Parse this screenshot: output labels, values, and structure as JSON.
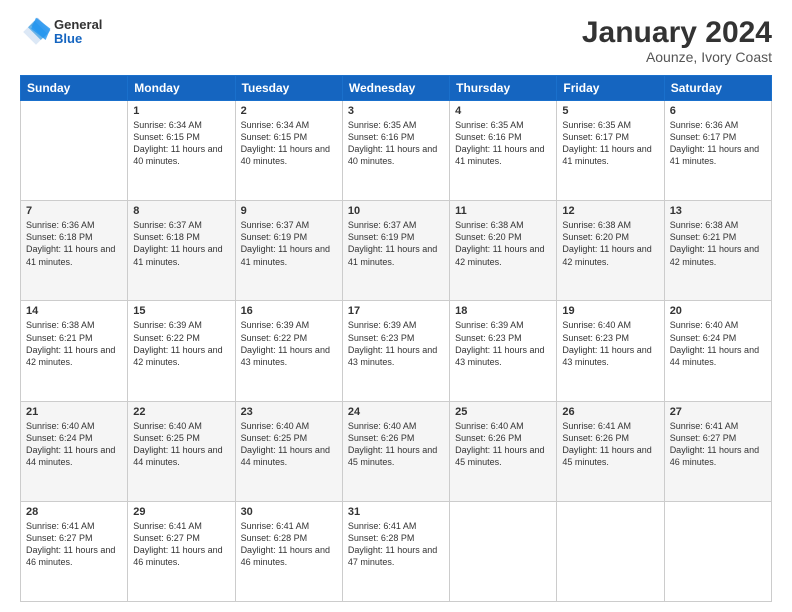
{
  "header": {
    "logo": {
      "general": "General",
      "blue": "Blue"
    },
    "title": "January 2024",
    "subtitle": "Aounze, Ivory Coast"
  },
  "days_of_week": [
    "Sunday",
    "Monday",
    "Tuesday",
    "Wednesday",
    "Thursday",
    "Friday",
    "Saturday"
  ],
  "weeks": [
    [
      {
        "num": "",
        "sunrise": "",
        "sunset": "",
        "daylight": ""
      },
      {
        "num": "1",
        "sunrise": "Sunrise: 6:34 AM",
        "sunset": "Sunset: 6:15 PM",
        "daylight": "Daylight: 11 hours and 40 minutes."
      },
      {
        "num": "2",
        "sunrise": "Sunrise: 6:34 AM",
        "sunset": "Sunset: 6:15 PM",
        "daylight": "Daylight: 11 hours and 40 minutes."
      },
      {
        "num": "3",
        "sunrise": "Sunrise: 6:35 AM",
        "sunset": "Sunset: 6:16 PM",
        "daylight": "Daylight: 11 hours and 40 minutes."
      },
      {
        "num": "4",
        "sunrise": "Sunrise: 6:35 AM",
        "sunset": "Sunset: 6:16 PM",
        "daylight": "Daylight: 11 hours and 41 minutes."
      },
      {
        "num": "5",
        "sunrise": "Sunrise: 6:35 AM",
        "sunset": "Sunset: 6:17 PM",
        "daylight": "Daylight: 11 hours and 41 minutes."
      },
      {
        "num": "6",
        "sunrise": "Sunrise: 6:36 AM",
        "sunset": "Sunset: 6:17 PM",
        "daylight": "Daylight: 11 hours and 41 minutes."
      }
    ],
    [
      {
        "num": "7",
        "sunrise": "Sunrise: 6:36 AM",
        "sunset": "Sunset: 6:18 PM",
        "daylight": "Daylight: 11 hours and 41 minutes."
      },
      {
        "num": "8",
        "sunrise": "Sunrise: 6:37 AM",
        "sunset": "Sunset: 6:18 PM",
        "daylight": "Daylight: 11 hours and 41 minutes."
      },
      {
        "num": "9",
        "sunrise": "Sunrise: 6:37 AM",
        "sunset": "Sunset: 6:19 PM",
        "daylight": "Daylight: 11 hours and 41 minutes."
      },
      {
        "num": "10",
        "sunrise": "Sunrise: 6:37 AM",
        "sunset": "Sunset: 6:19 PM",
        "daylight": "Daylight: 11 hours and 41 minutes."
      },
      {
        "num": "11",
        "sunrise": "Sunrise: 6:38 AM",
        "sunset": "Sunset: 6:20 PM",
        "daylight": "Daylight: 11 hours and 42 minutes."
      },
      {
        "num": "12",
        "sunrise": "Sunrise: 6:38 AM",
        "sunset": "Sunset: 6:20 PM",
        "daylight": "Daylight: 11 hours and 42 minutes."
      },
      {
        "num": "13",
        "sunrise": "Sunrise: 6:38 AM",
        "sunset": "Sunset: 6:21 PM",
        "daylight": "Daylight: 11 hours and 42 minutes."
      }
    ],
    [
      {
        "num": "14",
        "sunrise": "Sunrise: 6:38 AM",
        "sunset": "Sunset: 6:21 PM",
        "daylight": "Daylight: 11 hours and 42 minutes."
      },
      {
        "num": "15",
        "sunrise": "Sunrise: 6:39 AM",
        "sunset": "Sunset: 6:22 PM",
        "daylight": "Daylight: 11 hours and 42 minutes."
      },
      {
        "num": "16",
        "sunrise": "Sunrise: 6:39 AM",
        "sunset": "Sunset: 6:22 PM",
        "daylight": "Daylight: 11 hours and 43 minutes."
      },
      {
        "num": "17",
        "sunrise": "Sunrise: 6:39 AM",
        "sunset": "Sunset: 6:23 PM",
        "daylight": "Daylight: 11 hours and 43 minutes."
      },
      {
        "num": "18",
        "sunrise": "Sunrise: 6:39 AM",
        "sunset": "Sunset: 6:23 PM",
        "daylight": "Daylight: 11 hours and 43 minutes."
      },
      {
        "num": "19",
        "sunrise": "Sunrise: 6:40 AM",
        "sunset": "Sunset: 6:23 PM",
        "daylight": "Daylight: 11 hours and 43 minutes."
      },
      {
        "num": "20",
        "sunrise": "Sunrise: 6:40 AM",
        "sunset": "Sunset: 6:24 PM",
        "daylight": "Daylight: 11 hours and 44 minutes."
      }
    ],
    [
      {
        "num": "21",
        "sunrise": "Sunrise: 6:40 AM",
        "sunset": "Sunset: 6:24 PM",
        "daylight": "Daylight: 11 hours and 44 minutes."
      },
      {
        "num": "22",
        "sunrise": "Sunrise: 6:40 AM",
        "sunset": "Sunset: 6:25 PM",
        "daylight": "Daylight: 11 hours and 44 minutes."
      },
      {
        "num": "23",
        "sunrise": "Sunrise: 6:40 AM",
        "sunset": "Sunset: 6:25 PM",
        "daylight": "Daylight: 11 hours and 44 minutes."
      },
      {
        "num": "24",
        "sunrise": "Sunrise: 6:40 AM",
        "sunset": "Sunset: 6:26 PM",
        "daylight": "Daylight: 11 hours and 45 minutes."
      },
      {
        "num": "25",
        "sunrise": "Sunrise: 6:40 AM",
        "sunset": "Sunset: 6:26 PM",
        "daylight": "Daylight: 11 hours and 45 minutes."
      },
      {
        "num": "26",
        "sunrise": "Sunrise: 6:41 AM",
        "sunset": "Sunset: 6:26 PM",
        "daylight": "Daylight: 11 hours and 45 minutes."
      },
      {
        "num": "27",
        "sunrise": "Sunrise: 6:41 AM",
        "sunset": "Sunset: 6:27 PM",
        "daylight": "Daylight: 11 hours and 46 minutes."
      }
    ],
    [
      {
        "num": "28",
        "sunrise": "Sunrise: 6:41 AM",
        "sunset": "Sunset: 6:27 PM",
        "daylight": "Daylight: 11 hours and 46 minutes."
      },
      {
        "num": "29",
        "sunrise": "Sunrise: 6:41 AM",
        "sunset": "Sunset: 6:27 PM",
        "daylight": "Daylight: 11 hours and 46 minutes."
      },
      {
        "num": "30",
        "sunrise": "Sunrise: 6:41 AM",
        "sunset": "Sunset: 6:28 PM",
        "daylight": "Daylight: 11 hours and 46 minutes."
      },
      {
        "num": "31",
        "sunrise": "Sunrise: 6:41 AM",
        "sunset": "Sunset: 6:28 PM",
        "daylight": "Daylight: 11 hours and 47 minutes."
      },
      {
        "num": "",
        "sunrise": "",
        "sunset": "",
        "daylight": ""
      },
      {
        "num": "",
        "sunrise": "",
        "sunset": "",
        "daylight": ""
      },
      {
        "num": "",
        "sunrise": "",
        "sunset": "",
        "daylight": ""
      }
    ]
  ]
}
